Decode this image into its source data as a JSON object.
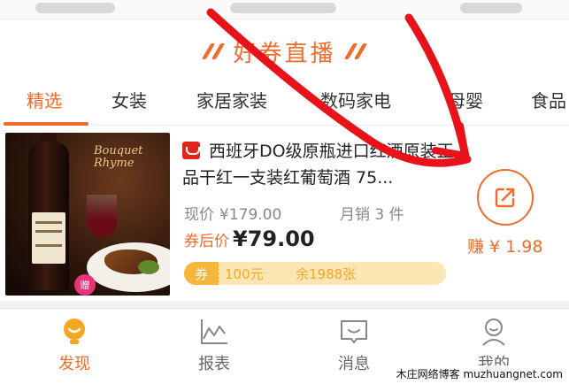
{
  "banner": {
    "title": "好券直播"
  },
  "tabs": [
    {
      "label": "精选",
      "active": true
    },
    {
      "label": "女装"
    },
    {
      "label": "家居家装"
    },
    {
      "label": "数码家电"
    },
    {
      "label": "母婴"
    },
    {
      "label": "食品"
    }
  ],
  "product": {
    "title": "西班牙DO级原瓶进口红酒原装正品干红一支装红葡萄酒 75...",
    "price_label": "现价",
    "price": "¥179.00",
    "sales": "月销 3 件",
    "coupon_price_label": "券后价",
    "coupon_price": "¥79.00",
    "coupon_tag": "券",
    "coupon_value": "100元",
    "coupon_left": "余1988张",
    "earn": "赚 ¥ 1.98",
    "image_text": "Bouquet Rhyme",
    "image_badge": "赠",
    "image_icon": "wine-bottle-icon"
  },
  "bottom_nav": [
    {
      "label": "发现",
      "icon": "lightbulb-icon",
      "active": true
    },
    {
      "label": "报表",
      "icon": "chart-icon"
    },
    {
      "label": "消息",
      "icon": "message-icon"
    },
    {
      "label": "我的",
      "icon": "person-icon"
    }
  ],
  "watermark": "木庄网络博客 muzhuangnet.com",
  "colors": {
    "accent": "#f26b2b",
    "coupon": "#f5b63a",
    "annotation": "#e8121b"
  }
}
